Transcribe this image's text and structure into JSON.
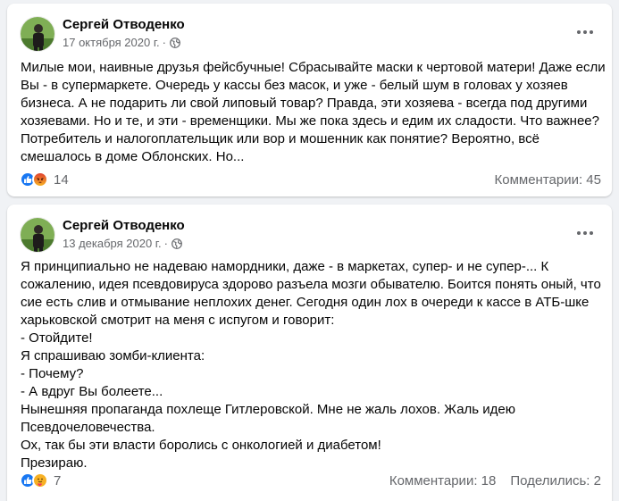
{
  "colors": {
    "background": "#f0f2f5",
    "card": "#ffffff",
    "secondary_text": "#65676b",
    "like_blue": "#1877f2",
    "angry_orange": "#e9710f",
    "care_yellow": "#f7b125"
  },
  "posts": [
    {
      "author": "Сергей Отводенко",
      "date": "17 октября 2020 г.",
      "date_sep": "·",
      "privacy_icon": "globe-icon",
      "text_lines": [
        "Милые мои, наивные друзья фейсбучные! Сбрасывайте маски к чертовой матери! Даже если",
        "Вы - в супермаркете. Очередь у кассы без масок, и уже - белый шум в головах у хозяев",
        "бизнеса. А не подарить ли свой липовый товар? Правда, эти хозяева - всегда под другими",
        "хозяевами. Но и те, и эти - временщики. Мы же пока здесь и едим их сладости. Что важнее?",
        "Потребитель и налогоплательщик или вор и мошенник как понятие? Вероятно, всё",
        "смешалось в доме Облонских. Но..."
      ],
      "reaction_icons": [
        "like-icon",
        "angry-icon"
      ],
      "reaction_count": "14",
      "comments": "Комментарии: 45"
    },
    {
      "author": "Сергей Отводенко",
      "date": "13 декабря 2020 г.",
      "date_sep": "·",
      "privacy_icon": "globe-icon",
      "text_lines": [
        "Я принципиально не надеваю намордники, даже - в маркетах, супер- и не супер-... К",
        "сожалению, идея псевдовируса здорово разъела мозги обывателю. Боится понять оный, что",
        "сие есть слив и отмывание неплохих денег. Сегодня один лох в очереди к кассе в АТБ-шке",
        "харьковской смотрит на меня с испугом и говорит:",
        "- Отойдите!",
        "Я спрашиваю зомби-клиента:",
        "- Почему?",
        "- А вдруг Вы болеете...",
        "Нынешняя пропаганда похлеще Гитлеровской. Мне не жаль лохов. Жаль идею",
        "Псевдочеловечества.",
        "Ох, так бы эти власти боролись с онкологией и диабетом!",
        "Презираю."
      ],
      "reaction_icons": [
        "like-icon",
        "care-icon"
      ],
      "reaction_count": "7",
      "comments": "Комментарии: 18",
      "shares": "Поделились: 2"
    }
  ]
}
